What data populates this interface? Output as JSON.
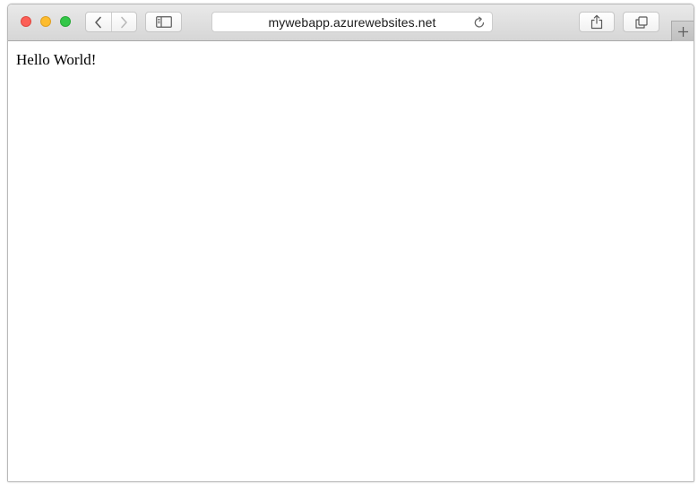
{
  "browser": {
    "address_bar": {
      "url": "mywebapp.azurewebsites.net"
    },
    "icons": {
      "back": "chevron-left-icon",
      "forward": "chevron-right-icon",
      "sidebar": "sidebar-icon",
      "reload": "reload-icon",
      "share": "share-icon",
      "tabs": "tabs-overview-icon",
      "new_tab": "plus-icon"
    },
    "colors": {
      "close": "#fc5f57",
      "minimize": "#fdbc2e",
      "zoom": "#33c748"
    }
  },
  "page": {
    "body_text": "Hello World!"
  }
}
